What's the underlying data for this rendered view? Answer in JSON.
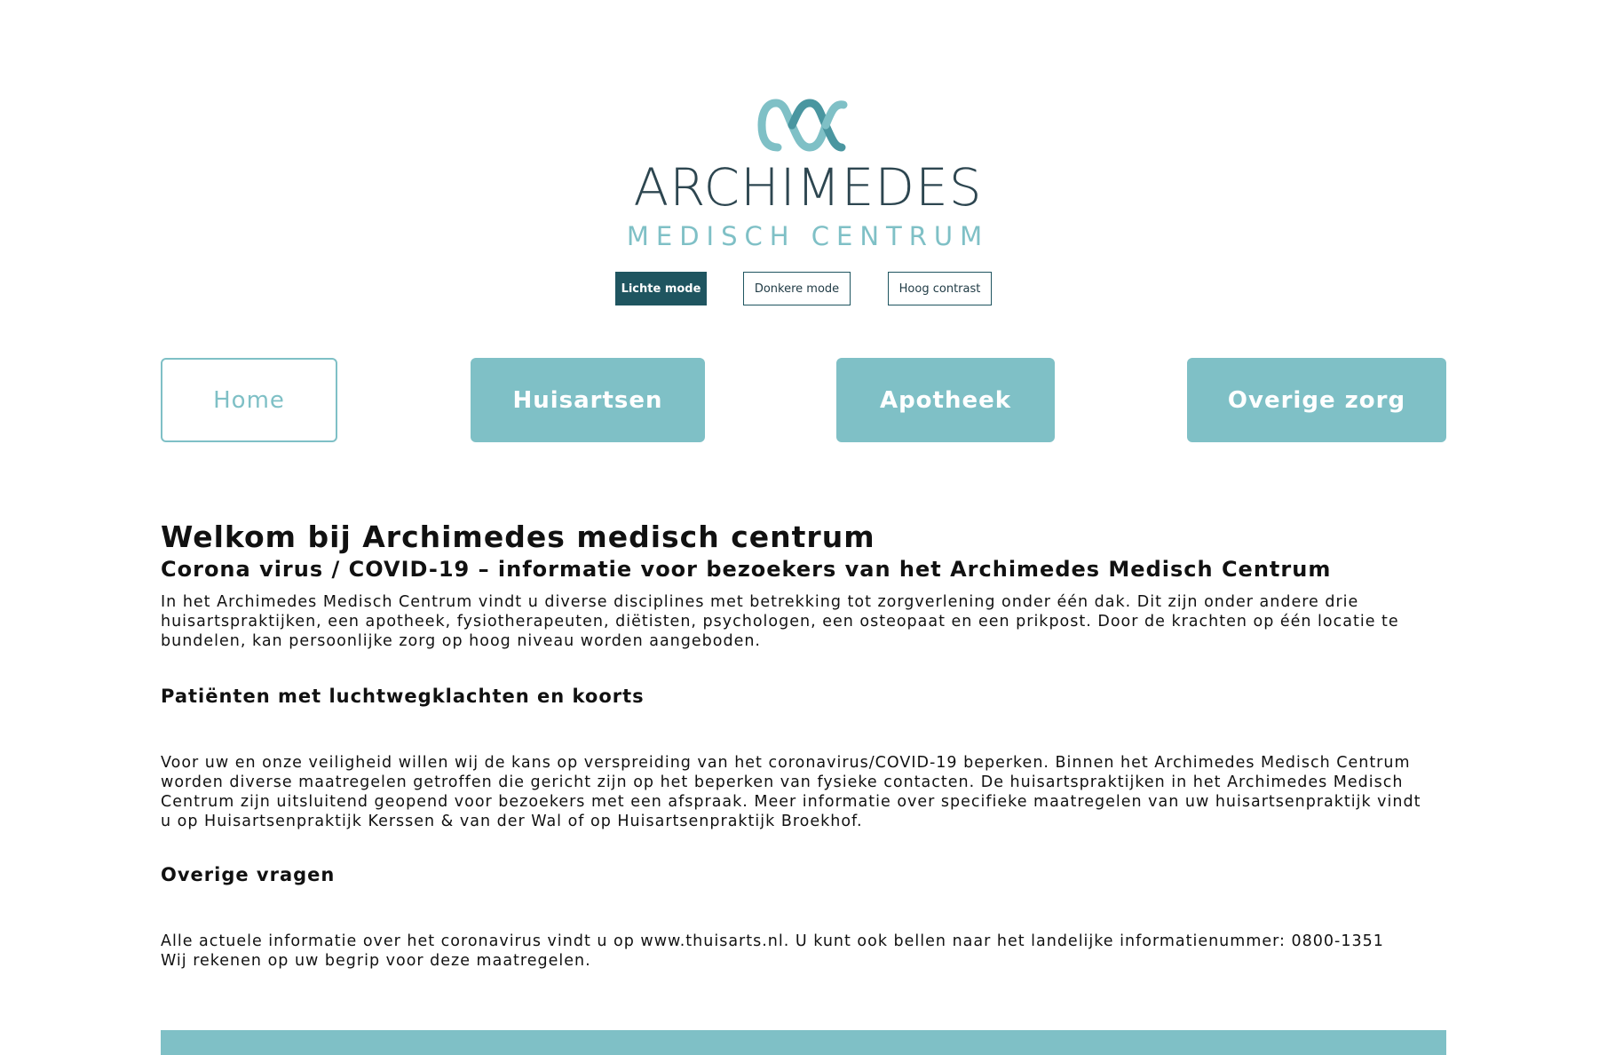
{
  "brand": {
    "logo_icon": "archimedes-wave-logo",
    "title": "ARCHIMEDES",
    "subtitle": "MEDISCH CENTRUM",
    "primary_color": "#2d4650",
    "accent_color": "#7fc0c6"
  },
  "display_modes": {
    "light_label": "Lichte mode",
    "dark_label": "Donkere mode",
    "contrast_label": "Hoog contrast",
    "active": "Lichte mode",
    "active_color": "#1f5560"
  },
  "nav": {
    "items": [
      {
        "label": "Home",
        "style": "outline"
      },
      {
        "label": "Huisartsen",
        "style": "filled"
      },
      {
        "label": "Apotheek",
        "style": "filled"
      },
      {
        "label": "Overige zorg",
        "style": "filled"
      }
    ]
  },
  "main": {
    "heading": "Welkom bij Archimedes medisch centrum",
    "subheading": "Corona virus / COVID-19 – informatie voor bezoekers van het Archimedes Medisch Centrum",
    "intro": "In het Archimedes Medisch Centrum vindt u diverse disciplines met betrekking tot zorgverlening onder één dak. Dit zijn onder andere drie huisartspraktijken, een apotheek, fysiotherapeuten, diëtisten, psychologen, een osteopaat en een prikpost. Door de krachten op één locatie te bundelen, kan persoonlijke zorg op hoog niveau worden aangeboden.",
    "sections": [
      {
        "title": "Patiënten met luchtwegklachten en koorts",
        "body": "Voor uw en onze veiligheid willen wij de kans op verspreiding van het coronavirus/COVID-19 beperken. Binnen het Archimedes Medisch Centrum worden diverse maatregelen getroffen die gericht zijn op het beperken van fysieke contacten. De huisartspraktijken in het Archimedes Medisch Centrum zijn uitsluitend geopend voor bezoekers met een afspraak. Meer informatie over specifieke maatregelen van uw huisartsenpraktijk vindt u op Huisartsenpraktijk Kerssen & van der Wal of op Huisartsenpraktijk Broekhof."
      },
      {
        "title": "Overige vragen",
        "body_line1": "Alle actuele informatie over het coronavirus vindt u op www.thuisarts.nl. U kunt ook bellen naar het landelijke informatienummer: 0800-1351",
        "body_line2": "Wij rekenen op uw begrip voor deze maatregelen."
      }
    ]
  }
}
